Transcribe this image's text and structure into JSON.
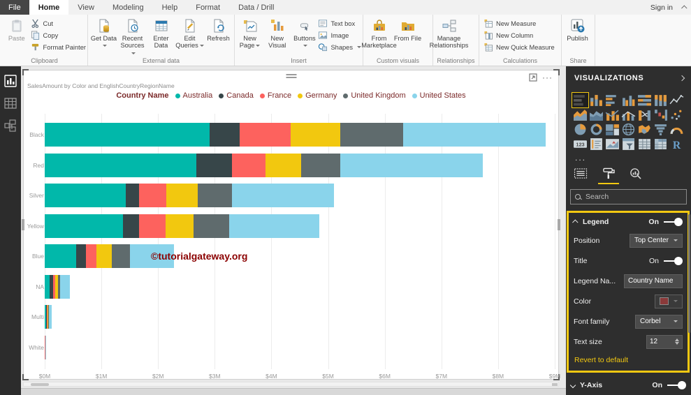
{
  "app": {
    "sign_in": "Sign in"
  },
  "ribbon": {
    "tabs": [
      "File",
      "Home",
      "View",
      "Modeling",
      "Help",
      "Format",
      "Data / Drill"
    ],
    "active_tab": "Home",
    "groups": [
      {
        "label": "Clipboard",
        "buttons": [
          {
            "label": "Paste",
            "icon": "paste-icon",
            "kind": "large",
            "disabled": true
          },
          {
            "label": "Cut",
            "icon": "cut-icon",
            "kind": "small"
          },
          {
            "label": "Copy",
            "icon": "copy-icon",
            "kind": "small"
          },
          {
            "label": "Format Painter",
            "icon": "format-painter-icon",
            "kind": "small"
          }
        ]
      },
      {
        "label": "External data",
        "buttons": [
          {
            "label": "Get Data",
            "icon": "get-data-icon",
            "kind": "large",
            "arrow": true
          },
          {
            "label": "Recent Sources",
            "icon": "recent-sources-icon",
            "kind": "large",
            "arrow": true
          },
          {
            "label": "Enter Data",
            "icon": "enter-data-icon",
            "kind": "large"
          },
          {
            "label": "Edit Queries",
            "icon": "edit-queries-icon",
            "kind": "large",
            "arrow": true
          },
          {
            "label": "Refresh",
            "icon": "refresh-icon",
            "kind": "large"
          }
        ]
      },
      {
        "label": "Insert",
        "buttons": [
          {
            "label": "New Page",
            "icon": "new-page-icon",
            "kind": "large",
            "arrow": true
          },
          {
            "label": "New Visual",
            "icon": "new-visual-icon",
            "kind": "large"
          },
          {
            "label": "Buttons",
            "icon": "buttons-icon",
            "kind": "large",
            "arrow": true
          },
          {
            "label": "Text box",
            "icon": "text-box-icon",
            "kind": "small"
          },
          {
            "label": "Image",
            "icon": "image-icon",
            "kind": "small"
          },
          {
            "label": "Shapes",
            "icon": "shapes-icon",
            "kind": "small",
            "arrow": true
          }
        ]
      },
      {
        "label": "Custom visuals",
        "buttons": [
          {
            "label": "From Marketplace",
            "icon": "from-marketplace-icon",
            "kind": "large"
          },
          {
            "label": "From File",
            "icon": "from-file-icon",
            "kind": "large"
          }
        ]
      },
      {
        "label": "Relationships",
        "buttons": [
          {
            "label": "Manage Relationships",
            "icon": "manage-relationships-icon",
            "kind": "large"
          }
        ]
      },
      {
        "label": "Calculations",
        "buttons": [
          {
            "label": "New Measure",
            "icon": "new-measure-icon",
            "kind": "small"
          },
          {
            "label": "New Column",
            "icon": "new-column-icon",
            "kind": "small"
          },
          {
            "label": "New Quick Measure",
            "icon": "new-quick-measure-icon",
            "kind": "small"
          }
        ]
      },
      {
        "label": "Share",
        "buttons": [
          {
            "label": "Publish",
            "icon": "publish-icon",
            "kind": "large"
          }
        ]
      }
    ]
  },
  "sidebar": {
    "items": [
      "report-view-icon",
      "data-view-icon",
      "model-view-icon"
    ]
  },
  "watermark": "©tutorialgateway.org",
  "chart_data": {
    "type": "bar",
    "subtype": "horizontal-stacked",
    "title": "SalesAmount by Color and EnglishCountryRegionName",
    "legend_title": "Country Name",
    "legend_position": "top-center",
    "categories": [
      "Black",
      "Red",
      "Silver",
      "Yellow",
      "Blue",
      "NA",
      "Multi",
      "White"
    ],
    "series": [
      {
        "name": "Australia",
        "color": "#01B8AA",
        "values": [
          2.91,
          2.68,
          1.43,
          1.38,
          0.55,
          0.09,
          0.025,
          0.004
        ]
      },
      {
        "name": "Canada",
        "color": "#374649",
        "values": [
          0.53,
          0.62,
          0.23,
          0.28,
          0.18,
          0.06,
          0.01,
          0.002
        ]
      },
      {
        "name": "France",
        "color": "#FD625E",
        "values": [
          0.9,
          0.59,
          0.49,
          0.47,
          0.18,
          0.04,
          0.012,
          0.001
        ]
      },
      {
        "name": "Germany",
        "color": "#F2C80F",
        "values": [
          0.87,
          0.63,
          0.55,
          0.5,
          0.27,
          0.04,
          0.015,
          0.001
        ]
      },
      {
        "name": "United Kingdom",
        "color": "#5F6B6D",
        "values": [
          1.12,
          0.69,
          0.6,
          0.62,
          0.32,
          0.04,
          0.012,
          0.001
        ]
      },
      {
        "name": "United States",
        "color": "#8AD4EB",
        "values": [
          2.51,
          2.52,
          1.81,
          1.59,
          0.78,
          0.17,
          0.05,
          0.003
        ]
      }
    ],
    "x_ticks": [
      "$0M",
      "$1M",
      "$2M",
      "$3M",
      "$4M",
      "$5M",
      "$6M",
      "$7M",
      "$8M",
      "$9M"
    ],
    "xlim": [
      0,
      9
    ],
    "grid": true
  },
  "pane": {
    "header": "VISUALIZATIONS",
    "icons": [
      "stacked-bar-chart-icon",
      "stacked-column-chart-icon",
      "clustered-bar-chart-icon",
      "clustered-column-chart-icon",
      "100-stacked-bar-chart-icon",
      "100-stacked-column-chart-icon",
      "line-chart-icon",
      "area-chart-icon",
      "stacked-area-chart-icon",
      "line-stacked-column-chart-icon",
      "line-clustered-column-chart-icon",
      "ribbon-chart-icon",
      "waterfall-chart-icon",
      "scatter-chart-icon",
      "pie-chart-icon",
      "donut-chart-icon",
      "treemap-icon",
      "map-icon",
      "filled-map-icon",
      "funnel-icon",
      "gauge-icon",
      "card-icon",
      "multi-row-card-icon",
      "kpi-icon",
      "slicer-icon",
      "table-icon",
      "matrix-icon",
      "r-script-icon"
    ],
    "selected_icon": "stacked-bar-chart-icon",
    "more": "...",
    "tabs": [
      "fields-tab-icon",
      "format-tab-icon",
      "analytics-tab-icon"
    ],
    "active_tab": "format-tab-icon",
    "search_placeholder": "Search",
    "legend_section": {
      "title": "Legend",
      "state": "On",
      "rows": [
        {
          "label": "Position",
          "type": "dropdown",
          "value": "Top Center"
        },
        {
          "label": "Title",
          "type": "toggle",
          "value": "On"
        },
        {
          "label": "Legend Na...",
          "type": "input",
          "value": "Country Name"
        },
        {
          "label": "Color",
          "type": "color",
          "value": "#8B3A3A"
        },
        {
          "label": "Font family",
          "type": "dropdown",
          "value": "Corbel"
        },
        {
          "label": "Text size",
          "type": "stepper",
          "value": "12"
        }
      ],
      "revert_label": "Revert to default"
    },
    "y_axis": {
      "label": "Y-Axis",
      "state": "On"
    }
  }
}
